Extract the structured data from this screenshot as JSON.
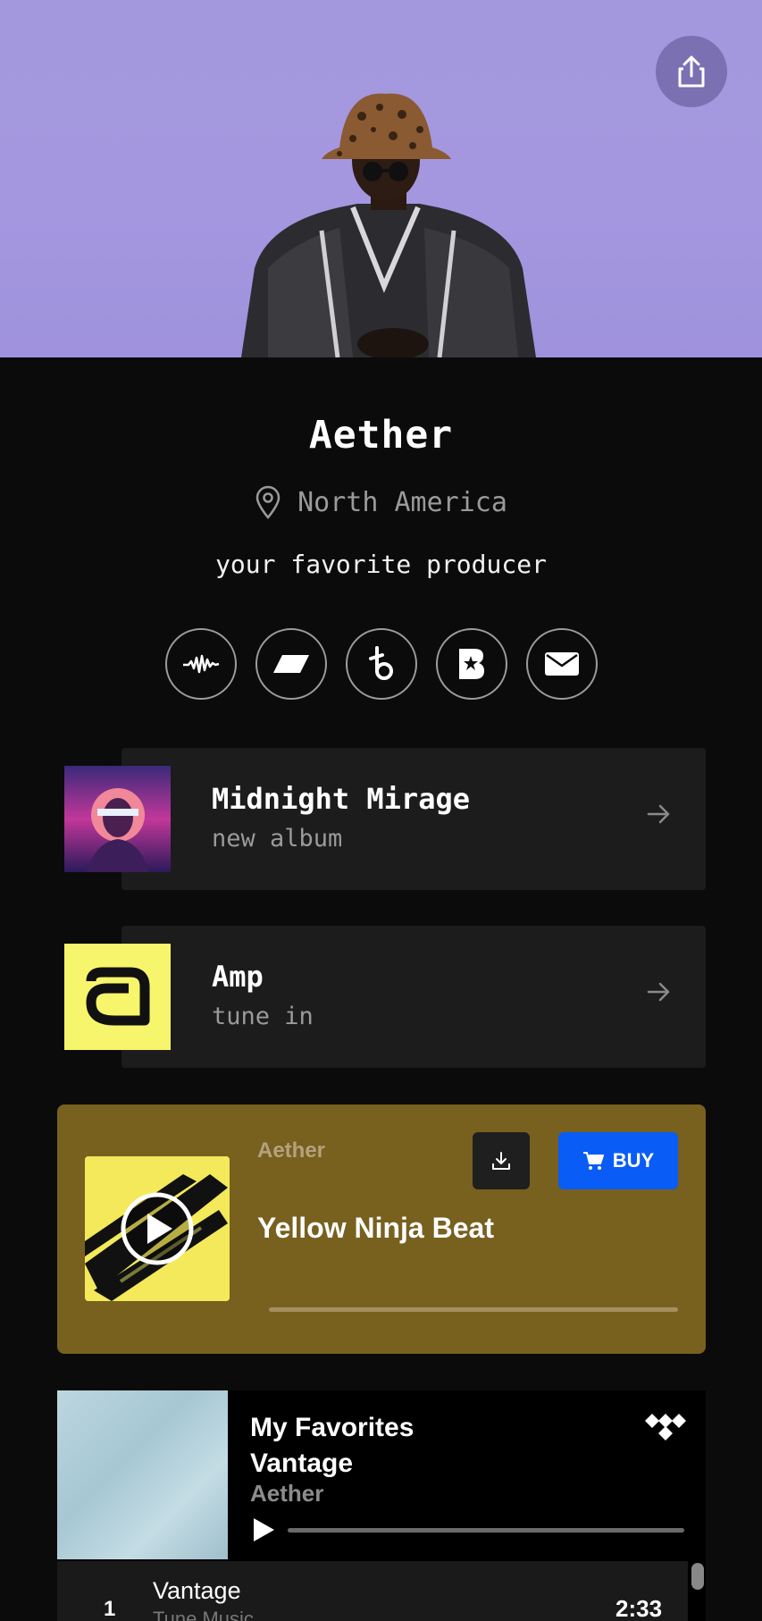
{
  "hero": {
    "share_icon": "share-icon"
  },
  "profile": {
    "name": "Aether",
    "location": "North America",
    "tagline": "your favorite producer"
  },
  "socials": [
    {
      "icon": "audiomack-icon"
    },
    {
      "icon": "parallelogram-icon"
    },
    {
      "icon": "beatstars-icon"
    },
    {
      "icon": "bandcamp-b-icon"
    },
    {
      "icon": "email-icon"
    }
  ],
  "links": [
    {
      "title": "Midnight Mirage",
      "subtitle": "new album"
    },
    {
      "title": "Amp",
      "subtitle": "tune in"
    }
  ],
  "player": {
    "artist": "Aether",
    "track": "Yellow Ninja Beat",
    "buy_label": "BUY",
    "colors": {
      "card": "#78601f",
      "buy": "#0a5cf6"
    }
  },
  "playlist": {
    "title_line1": "My Favorites",
    "title_line2": "Vantage",
    "artist": "Aether",
    "rows": [
      {
        "num": "1",
        "name": "Vantage",
        "sub": "Tune Music",
        "time": "2:33"
      }
    ]
  }
}
